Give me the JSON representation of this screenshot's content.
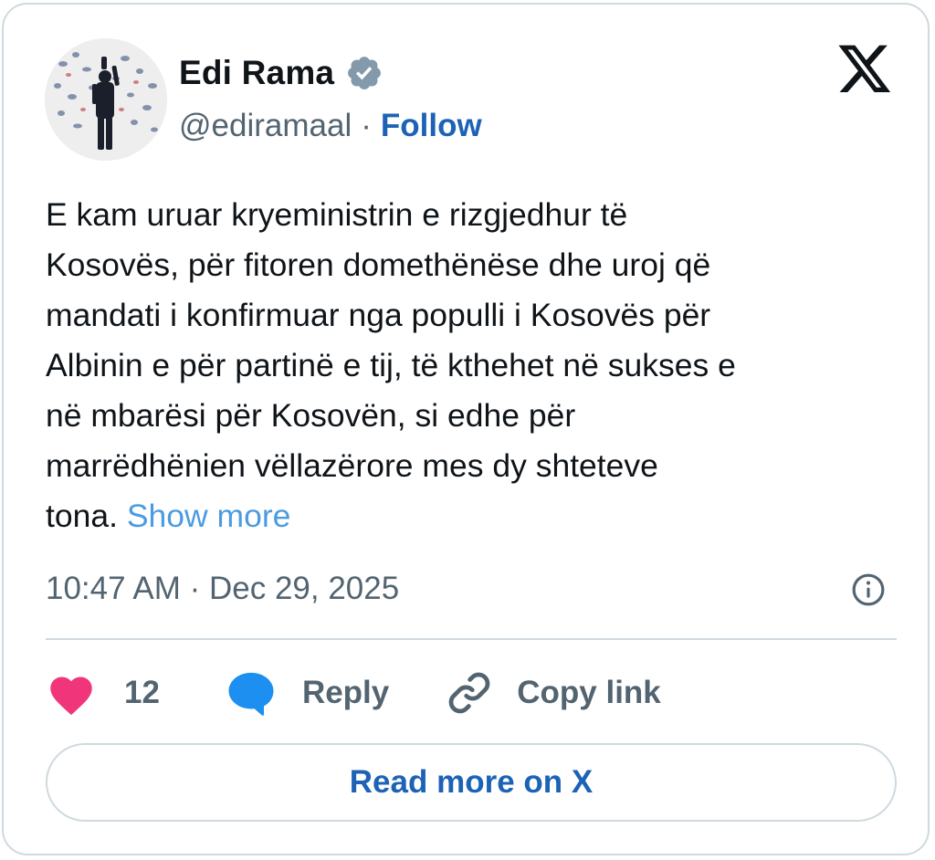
{
  "author": {
    "display_name": "Edi Rama",
    "handle": "@ediramaal",
    "separator": "·",
    "follow_label": "Follow",
    "verified": true
  },
  "icons": {
    "brand": "x-logo-icon",
    "verified": "verified-badge-icon",
    "info": "info-icon",
    "like": "heart-icon",
    "reply": "speech-bubble-icon",
    "copy": "link-icon"
  },
  "tweet": {
    "lines": [
      "E kam uruar kryeministrin e rizgjedhur të",
      "Kosovës, për fitoren domethënëse dhe uroj që",
      "mandati i konfirmuar nga populli i Kosovës për",
      "Albinin e për partinë e tij, të kthehet në sukses e",
      "në mbarësi për Kosovën, si edhe për",
      "marrëdhënien vëllazërore mes dy shteteve",
      "tona."
    ],
    "show_more_label": "Show more",
    "timestamp": "10:47 AM · Dec 29, 2025"
  },
  "actions": {
    "like_count": "12",
    "reply_label": "Reply",
    "copy_label": "Copy link"
  },
  "footer": {
    "read_more_label": "Read more on X"
  },
  "colors": {
    "text": "#0f1419",
    "secondary": "#536471",
    "link": "#1d63b5",
    "show_more": "#4c9be0",
    "heart": "#f0357a",
    "reply_bubble": "#1d8ff0",
    "verified": "#829aab",
    "border": "#cfd9de"
  }
}
